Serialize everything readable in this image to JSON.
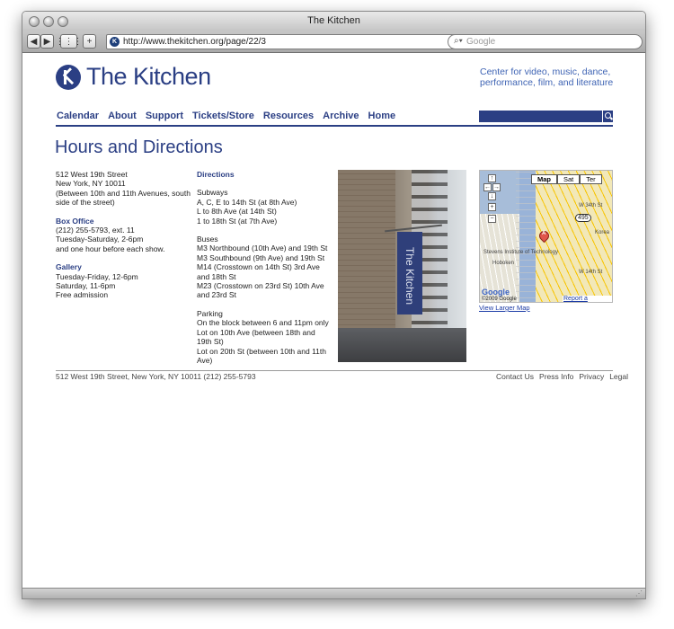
{
  "window": {
    "title": "The Kitchen",
    "url": "http://www.thekitchen.org/page/22/3",
    "search_placeholder": "Google"
  },
  "header": {
    "logo_text": "The Kitchen",
    "tagline": "Center for video, music, dance, performance, film, and literature"
  },
  "nav": {
    "items": [
      "Calendar",
      "About",
      "Support",
      "Tickets/Store",
      "Resources",
      "Archive",
      "Home"
    ]
  },
  "page": {
    "title": "Hours and Directions"
  },
  "left_col": {
    "address_lines": [
      "512 West 19th Street",
      "New York, NY 10011",
      "(Between 10th and 11th Avenues, south side of the street)"
    ],
    "box_office_title": "Box Office",
    "box_office_lines": [
      "(212) 255-5793, ext. 11",
      "Tuesday-Saturday, 2-6pm",
      "and one hour before each show."
    ],
    "gallery_title": "Gallery",
    "gallery_lines": [
      "Tuesday-Friday, 12-6pm",
      "Saturday, 11-6pm",
      "Free admission"
    ]
  },
  "directions": {
    "title": "Directions",
    "subways_title": "Subways",
    "subways": [
      "A, C, E to 14th St (at 8th Ave)",
      "L to 8th Ave (at 14th St)",
      "1 to 18th St (at 7th Ave)"
    ],
    "buses_title": "Buses",
    "buses": [
      "M3 Northbound (10th Ave) and 19th St",
      "M3 Southbound (9th Ave) and 19th St",
      "M14 (Crosstown on 14th St) 3rd Ave and 18th St",
      "M23 (Crosstown on 23rd St) 10th Ave and 23rd St"
    ],
    "parking_title": "Parking",
    "parking": [
      "On the block between 6 and 11pm only",
      "Lot on 10th Ave (between 18th and 19th St)",
      "Lot on 20th St (between 10th and 11th Ave)"
    ]
  },
  "photo": {
    "banner_text": "The Kitchen"
  },
  "map": {
    "types": [
      "Map",
      "Sat",
      "Ter"
    ],
    "active_type": "Map",
    "highway": "495",
    "marker_label": "A",
    "labels": [
      "Stevens Institute of Technology",
      "Hoboken",
      "W 34th St",
      "W 14th St",
      "Korea"
    ],
    "google": "Google",
    "copyright": "©2009 Google",
    "report": "Report a problem",
    "larger": "View Larger Map"
  },
  "footer": {
    "address": "512 West 19th Street, New York, NY 10011 (212) 255-5793",
    "links": [
      "Contact Us",
      "Press Info",
      "Privacy",
      "Legal"
    ]
  }
}
